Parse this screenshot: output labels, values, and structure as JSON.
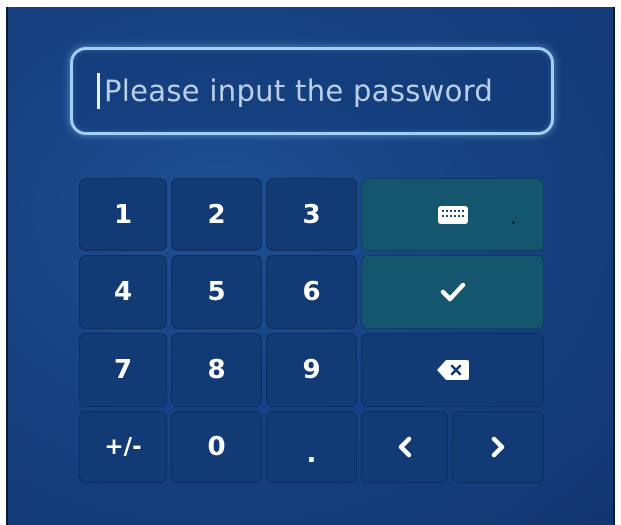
{
  "password_field": {
    "placeholder": "Please input the password"
  },
  "keypad": {
    "keys": [
      "1",
      "2",
      "3",
      "4",
      "5",
      "6",
      "7",
      "8",
      "9",
      "+/-",
      "0",
      "."
    ],
    "icons": {
      "keyboard": "keyboard-icon",
      "confirm": "check-icon",
      "backspace": "backspace-icon",
      "left": "chevron-left-icon",
      "right": "chevron-right-icon"
    }
  },
  "colors": {
    "background": "#174282",
    "key": "#123a74",
    "accent_key": "#13566e",
    "field_border": "#9fd0f6"
  }
}
